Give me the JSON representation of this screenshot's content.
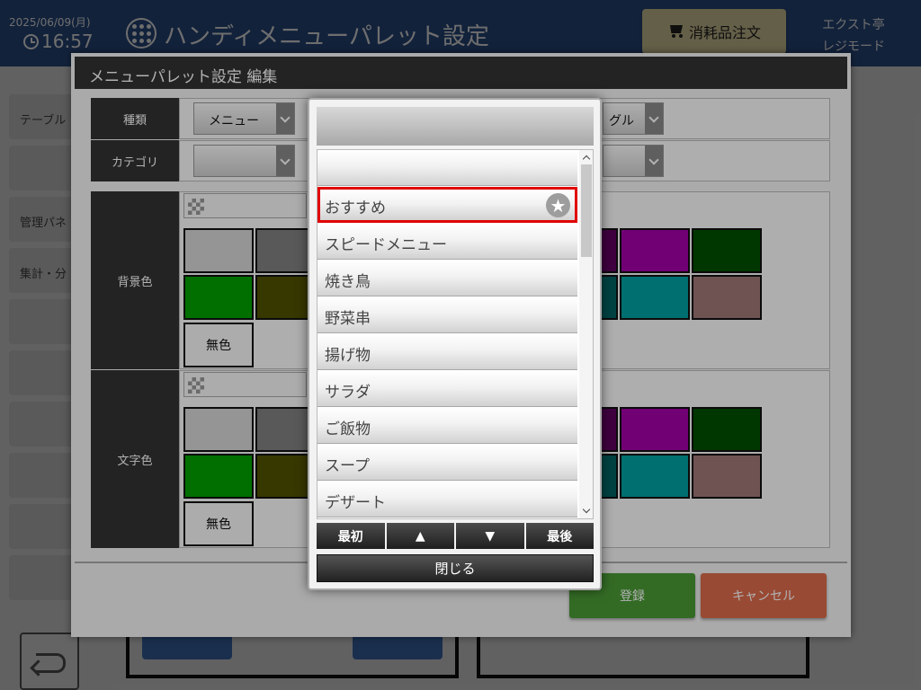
{
  "topbar": {
    "date": "2025/06/09(月)",
    "time": "16:57",
    "title": "ハンディメニューパレット設定",
    "order_button": "消耗品注文",
    "store_name": "エクスト亭",
    "mode": "レジモード"
  },
  "sidebar": {
    "items": [
      "テーブル",
      "",
      "管理パネ",
      "集計・分",
      "",
      "",
      "",
      "",
      "",
      ""
    ]
  },
  "editor": {
    "title": "メニューパレット設定 編集",
    "type_label": "種類",
    "type_value": "メニュー",
    "second_select_value": "グル",
    "category_label": "カテゴリ",
    "category_value": "",
    "bg_color_label": "背景色",
    "text_color_label": "文字色",
    "no_color": "無色",
    "register_button": "登録",
    "cancel_button": "キャンセル",
    "palette_colors": [
      "#d6d6d6",
      "#808080",
      "#5b005b",
      "#a300a8",
      "#004f00",
      "#00a000",
      "#4f4f00",
      "#005f5f",
      "#00a0a0",
      "#a07878"
    ]
  },
  "picker": {
    "header": "",
    "items": [
      "",
      "おすすめ",
      "スピードメニュー",
      "焼き鳥",
      "野菜串",
      "揚げ物",
      "サラダ",
      "ご飯物",
      "スープ",
      "デザート"
    ],
    "selected_index": 1,
    "first_button": "最初",
    "up_button": "▲",
    "down_button": "▼",
    "last_button": "最後",
    "close_button": "閉じる"
  },
  "colors": {
    "topbar": "#2d4f8a",
    "selection_border": "#e00000",
    "register": "#4a9a36",
    "cancel": "#db6a4b"
  }
}
